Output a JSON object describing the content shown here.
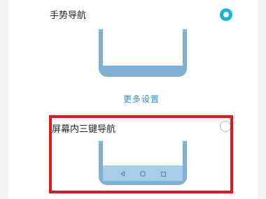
{
  "options": {
    "gesture_label": "手势导航",
    "three_key_label": "屏幕内三键导航"
  },
  "more_settings_label": "更多设置",
  "colors": {
    "accent": "#1bb4d4",
    "illustration": "#7fb0d6",
    "link": "#2a8fcf",
    "highlight": "#e8141a"
  },
  "icons": {
    "nav_back": "triangle-back-icon",
    "nav_home": "circle-home-icon",
    "nav_recent": "square-recent-icon"
  }
}
